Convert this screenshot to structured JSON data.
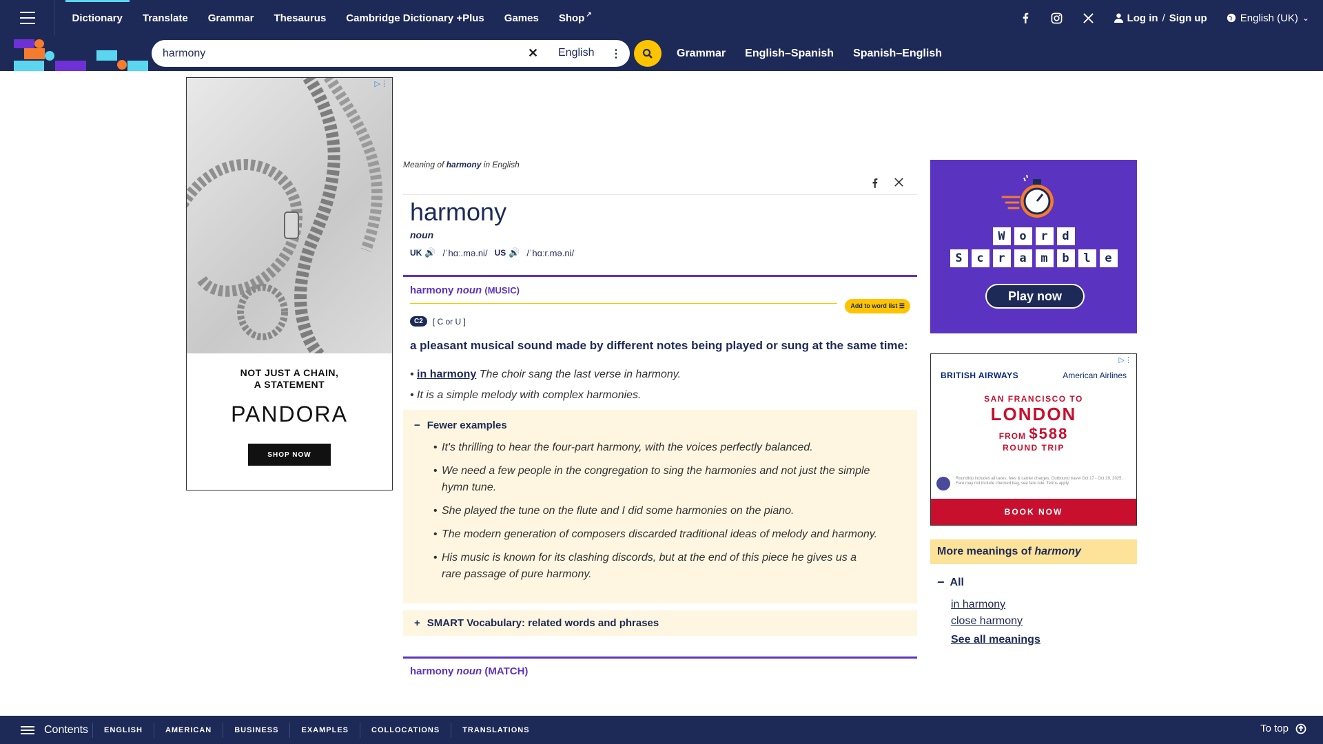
{
  "nav": {
    "items": [
      "Dictionary",
      "Translate",
      "Grammar",
      "Thesaurus",
      "Cambridge Dictionary +Plus",
      "Games",
      "Shop"
    ],
    "login": "Log in",
    "signup": "Sign up",
    "language": "English (UK)"
  },
  "search": {
    "value": "harmony",
    "dictionary": "English",
    "links": [
      "Grammar",
      "English–Spanish",
      "Spanish–English"
    ]
  },
  "ad_left": {
    "tagline_1": "NOT JUST A CHAIN,",
    "tagline_2": "A STATEMENT",
    "brand": "PANDORA",
    "cta": "SHOP NOW"
  },
  "entry": {
    "meaning_prefix": "Meaning of",
    "meaning_word": "harmony",
    "meaning_suffix": "in English",
    "headword": "harmony",
    "pos": "noun",
    "uk_label": "UK",
    "uk_ipa": "/ˈhɑː.mə.ni/",
    "us_label": "US",
    "us_ipa": "/ˈhɑːr.mə.ni/",
    "sense": {
      "word": "harmony",
      "pos": "noun",
      "guide": "(MUSIC)",
      "add_to_list": "Add to word list",
      "cefr": "C2",
      "grammar": "[ C or U ]",
      "definition": "a pleasant musical sound made by different notes being played or sung at the same time:",
      "examples": [
        {
          "phrase": "in harmony",
          "text": "The choir sang the last verse in harmony."
        },
        {
          "phrase": "",
          "text": "It is a simple melody with complex harmonies."
        }
      ],
      "fewer_label": "Fewer examples",
      "more_examples": [
        "It's thrilling to hear the four-part harmony, with the voices perfectly balanced.",
        "We need a few people in the congregation to sing the harmonies and not just the simple hymn tune.",
        "She played the tune on the flute and I did some harmonies on the piano.",
        "The modern generation of composers discarded traditional ideas of melody and harmony.",
        "His music is known for its clashing discords, but at the end of this piece he gives us a rare passage of pure harmony."
      ],
      "smart_vocab": "SMART Vocabulary: related words and phrases"
    },
    "next_sense": {
      "word": "harmony",
      "pos": "noun",
      "guide": "(MATCH)"
    }
  },
  "ad_game": {
    "row1": [
      "W",
      "o",
      "r",
      "d"
    ],
    "row2": [
      "S",
      "c",
      "r",
      "a",
      "m",
      "b",
      "l",
      "e"
    ],
    "cta": "Play now"
  },
  "ad_air": {
    "airline1": "BRITISH AIRWAYS",
    "airline2": "American Airlines",
    "route": "SAN FRANCISCO TO",
    "city": "LONDON",
    "from": "FROM",
    "price": "$588",
    "trip": "ROUND TRIP",
    "fine": "Roundtrip includes all taxes, fees & carrier charges. Outbound travel Oct 17 - Oct 29, 2025. Fare may not include checked bag, see fare rule. Terms apply.",
    "cta": "BOOK NOW"
  },
  "more_meanings": {
    "title_prefix": "More meanings of",
    "title_word": "harmony",
    "all": "All",
    "links": [
      "in harmony",
      "close harmony"
    ],
    "see_all": "See all meanings"
  },
  "bottom": {
    "contents": "Contents",
    "tabs": [
      "ENGLISH",
      "AMERICAN",
      "BUSINESS",
      "EXAMPLES",
      "COLLOCATIONS",
      "TRANSLATIONS"
    ],
    "to_top": "To top"
  },
  "colors": {
    "navy": "#1d2a57",
    "purple": "#5a34c0",
    "yellow": "#fec400",
    "cream": "#fef6e0"
  }
}
